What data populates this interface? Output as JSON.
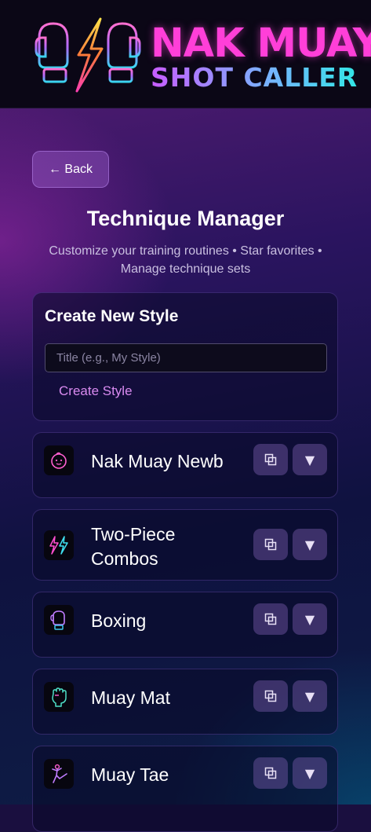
{
  "header": {
    "title_line1": "NAK MUAY",
    "title_line2": "SHOT CALLER",
    "logo_icon": "boxing-gloves-lightning-logo"
  },
  "nav": {
    "back_label": "← Back"
  },
  "page": {
    "title": "Technique Manager",
    "subtitle": "Customize your training routines • Star favorites • Manage technique sets"
  },
  "create": {
    "heading": "Create New Style",
    "placeholder": "Title (e.g., My Style)",
    "value": "",
    "button_label": "Create Style"
  },
  "styles": [
    {
      "name": "Nak Muay Newb",
      "icon": "baby-face-icon"
    },
    {
      "name": "Two-Piece Combos",
      "icon": "double-lightning-icon"
    },
    {
      "name": "Boxing",
      "icon": "boxing-glove-icon"
    },
    {
      "name": "Muay Mat",
      "icon": "fist-icon"
    },
    {
      "name": "Muay Tae",
      "icon": "kick-icon"
    }
  ],
  "actions": {
    "duplicate_icon": "duplicate-icon",
    "expand_icon": "expand-triangle-icon",
    "expand_glyph": "▼"
  },
  "colors": {
    "accent_pink": "#ff3fd8",
    "accent_cyan": "#32e6e6",
    "background": "#1a0f3f"
  }
}
